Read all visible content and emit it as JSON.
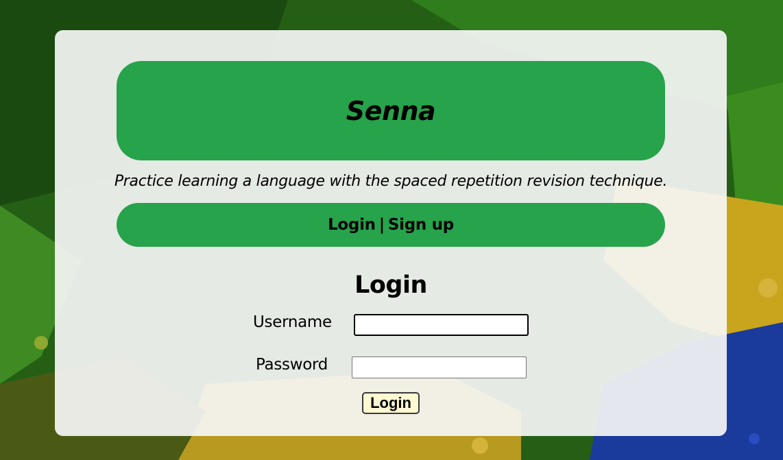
{
  "header": {
    "app_title": "Senna"
  },
  "tagline": "Practice learning a language with the spaced repetition revision technique.",
  "nav": {
    "login_label": "Login",
    "separator": "|",
    "signup_label": "Sign up"
  },
  "login_form": {
    "heading": "Login",
    "username_label": "Username",
    "username_value": "",
    "password_label": "Password",
    "password_value": "",
    "submit_label": "Login"
  },
  "colors": {
    "accent_green": "#26a34b",
    "card_background": "#f6f6f6",
    "button_background": "#fdf8d2",
    "background_green": "#1e5a14",
    "background_yellow": "#c9a51e",
    "background_blue": "#1a3a9c"
  }
}
